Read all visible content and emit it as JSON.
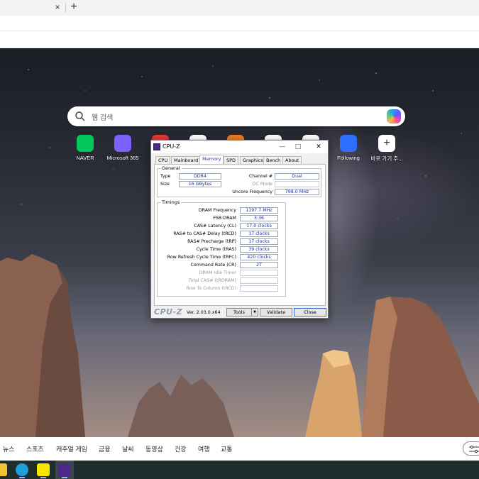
{
  "browser": {
    "tab_close": "×",
    "new_tab": "+"
  },
  "search": {
    "placeholder": "웹 검색"
  },
  "quick_links": [
    {
      "label": "NAVER",
      "icon": "naver-icon",
      "color": "#03c75a"
    },
    {
      "label": "Microsoft 365",
      "icon": "m365-icon",
      "color": "#7b61ff"
    },
    {
      "label": "",
      "icon": "site-icon",
      "color": "#e03a3a"
    },
    {
      "label": "",
      "icon": "site-icon",
      "color": "#ffffff"
    },
    {
      "label": "",
      "icon": "site-icon",
      "color": "#f07b22"
    },
    {
      "label": "",
      "icon": "site-icon",
      "color": "#ffffff"
    },
    {
      "label": "",
      "icon": "site-icon",
      "color": "#ffffff"
    },
    {
      "label": "Following",
      "icon": "following-icon",
      "color": "#2e6fff"
    },
    {
      "label": "바로 가기 추...",
      "icon": "plus-icon",
      "color": "#ffffff",
      "glyph": "+"
    }
  ],
  "cpuz": {
    "title": "CPU-Z",
    "window_buttons": {
      "minimize": "—",
      "maximize": "□",
      "close": "✕"
    },
    "tabs": [
      "CPU",
      "Mainboard",
      "Memory",
      "SPD",
      "Graphics",
      "Bench",
      "About"
    ],
    "active_tab": "Memory",
    "general": {
      "title": "General",
      "type_label": "Type",
      "type_value": "DDR4",
      "size_label": "Size",
      "size_value": "16 GBytes",
      "channel_label": "Channel #",
      "channel_value": "Dual",
      "dc_mode_label": "DC Mode",
      "dc_mode_value": "",
      "uncore_label": "Uncore Frequency",
      "uncore_value": "798.0 MHz"
    },
    "timings": {
      "title": "Timings",
      "rows": [
        {
          "label": "DRAM Frequency",
          "value": "1197.7 MHz",
          "dim": false
        },
        {
          "label": "FSB:DRAM",
          "value": "3:36",
          "dim": false
        },
        {
          "label": "CAS# Latency (CL)",
          "value": "17.0 clocks",
          "dim": false
        },
        {
          "label": "RAS# to CAS# Delay (tRCD)",
          "value": "17 clocks",
          "dim": false
        },
        {
          "label": "RAS# Precharge (tRP)",
          "value": "17 clocks",
          "dim": false
        },
        {
          "label": "Cycle Time (tRAS)",
          "value": "39 clocks",
          "dim": false
        },
        {
          "label": "Row Refresh Cycle Time (tRFC)",
          "value": "420 clocks",
          "dim": false
        },
        {
          "label": "Command Rate (CR)",
          "value": "2T",
          "dim": false
        },
        {
          "label": "DRAM Idle Timer",
          "value": "",
          "dim": true
        },
        {
          "label": "Total CAS# (tRDRAM)",
          "value": "",
          "dim": true
        },
        {
          "label": "Row To Column (tRCD)",
          "value": "",
          "dim": true
        }
      ]
    },
    "footer": {
      "logo": "CPU-Z",
      "version": "Ver. 2.03.0.x64",
      "tools_label": "Tools",
      "tools_arrow": "▼",
      "validate_label": "Validate",
      "close_label": "Close"
    }
  },
  "news_bar": {
    "items": [
      "뉴스",
      "스포츠",
      "캐주얼 게임",
      "금융",
      "날씨",
      "동영상",
      "건강",
      "여행",
      "교통"
    ]
  },
  "taskbar": {
    "icons": [
      {
        "name": "windows-start-icon",
        "color": "#f2c230"
      },
      {
        "name": "edge-icon",
        "color": "#1f9ed8"
      },
      {
        "name": "kakaotalk-icon",
        "color": "#f7e600"
      },
      {
        "name": "cpuz-icon",
        "color": "#4b2a87"
      }
    ]
  }
}
